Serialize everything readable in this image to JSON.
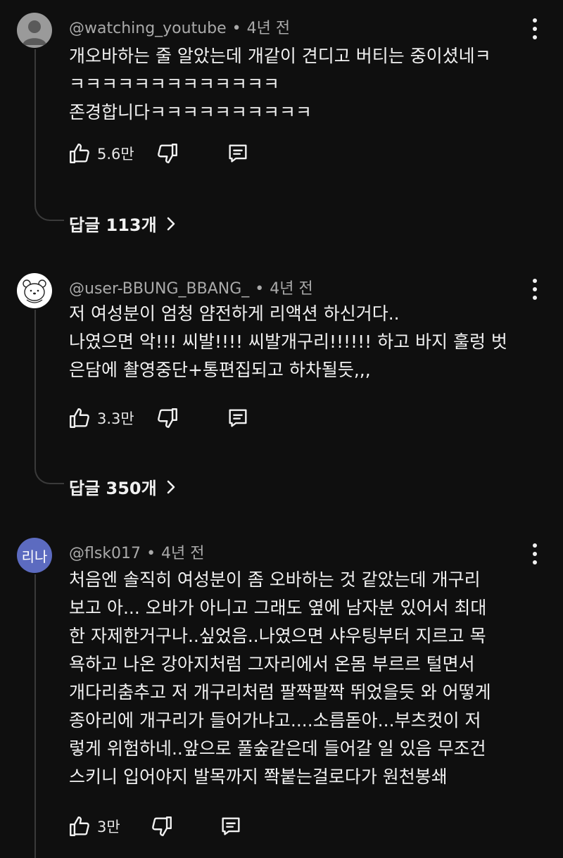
{
  "comments": [
    {
      "handle": "@watching_youtube",
      "time": "4년 전",
      "lines": [
        "개오바하는 줄 알았는데 개같이 견디고 버티는 중이셨네ㅋ",
        "ㅋㅋㅋㅋㅋㅋㅋㅋㅋㅋㅋㅋㅋ",
        "존경합니다ㅋㅋㅋㅋㅋㅋㅋㅋㅋㅋ"
      ],
      "likes": "5.6만",
      "replies_label": "답글 113개"
    },
    {
      "handle": "@user-BBUNG_BBANG_",
      "time": "4년 전",
      "lines": [
        "저 여성분이 엄청 얌전하게 리액션 하신거다..",
        "나였으면 악!!! 씨발!!!! 씨발개구리!!!!!! 하고 바지 훌렁 벗",
        "은담에 촬영중단+통편집되고 하차될듯,,,"
      ],
      "likes": "3.3만",
      "replies_label": "답글 350개"
    },
    {
      "handle": "@flsk017",
      "time": "4년 전",
      "avatar_text": "리나",
      "lines": [
        "처음엔 솔직히 여성분이 좀 오바하는 것 같았는데 개구리",
        "보고 아... 오바가 아니고 그래도 옆에 남자분 있어서 최대",
        "한 자제한거구나..싶었음..나였으면 샤우팅부터 지르고 목",
        "욕하고 나온 강아지처럼 그자리에서 온몸 부르르 털면서",
        "개다리춤추고 저 개구리처럼 팔짝팔짝 뛰었을듯 와 어떻게",
        "종아리에 개구리가 들어가냐고....소름돋아...부츠컷이 저",
        "렇게 위험하네..앞으로 풀숲같은데 들어갈 일 있음 무조건",
        "스키니 입어야지 발목까지 쫙붙는걸로다가  원천봉쇄"
      ],
      "likes": "3만"
    }
  ],
  "colors": {
    "background": "#0f0f0f",
    "text": "#f1f1f1",
    "meta": "#aaaaaa",
    "thread": "#3a3a3a",
    "avatar3": "#5c6bc0"
  },
  "icons": [
    "default-avatar-icon",
    "bear-avatar-icon",
    "thumbs-up-icon",
    "thumbs-down-icon",
    "reply-icon",
    "more-vert-icon",
    "chevron-right-icon"
  ]
}
